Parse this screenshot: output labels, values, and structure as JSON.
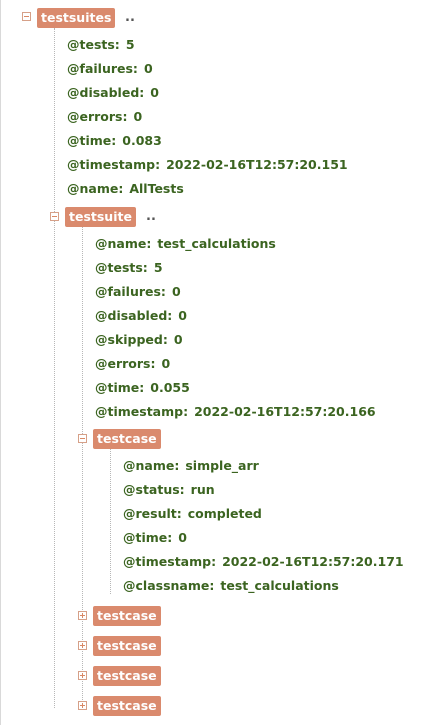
{
  "root": {
    "tag": "testsuites",
    "ellipsis": "..",
    "attrs": [
      {
        "key": "@tests:",
        "value": "5"
      },
      {
        "key": "@failures:",
        "value": "0"
      },
      {
        "key": "@disabled:",
        "value": "0"
      },
      {
        "key": "@errors:",
        "value": "0"
      },
      {
        "key": "@time:",
        "value": "0.083"
      },
      {
        "key": "@timestamp:",
        "value": "2022-02-16T12:57:20.151"
      },
      {
        "key": "@name:",
        "value": "AllTests"
      }
    ]
  },
  "suite": {
    "tag": "testsuite",
    "ellipsis": "..",
    "attrs": [
      {
        "key": "@name:",
        "value": "test_calculations"
      },
      {
        "key": "@tests:",
        "value": "5"
      },
      {
        "key": "@failures:",
        "value": "0"
      },
      {
        "key": "@disabled:",
        "value": "0"
      },
      {
        "key": "@skipped:",
        "value": "0"
      },
      {
        "key": "@errors:",
        "value": "0"
      },
      {
        "key": "@time:",
        "value": "0.055"
      },
      {
        "key": "@timestamp:",
        "value": "2022-02-16T12:57:20.166"
      }
    ]
  },
  "case": {
    "tag": "testcase",
    "attrs": [
      {
        "key": "@name:",
        "value": "simple_arr"
      },
      {
        "key": "@status:",
        "value": "run"
      },
      {
        "key": "@result:",
        "value": "completed"
      },
      {
        "key": "@time:",
        "value": "0"
      },
      {
        "key": "@timestamp:",
        "value": "2022-02-16T12:57:20.171"
      },
      {
        "key": "@classname:",
        "value": "test_calculations"
      }
    ]
  },
  "collapsed_cases": [
    {
      "tag": "testcase"
    },
    {
      "tag": "testcase"
    },
    {
      "tag": "testcase"
    },
    {
      "tag": "testcase"
    }
  ],
  "colors": {
    "tag_bg": "#da8a6d",
    "attr_text": "#3b6420",
    "toggle_border": "#d6a088"
  }
}
